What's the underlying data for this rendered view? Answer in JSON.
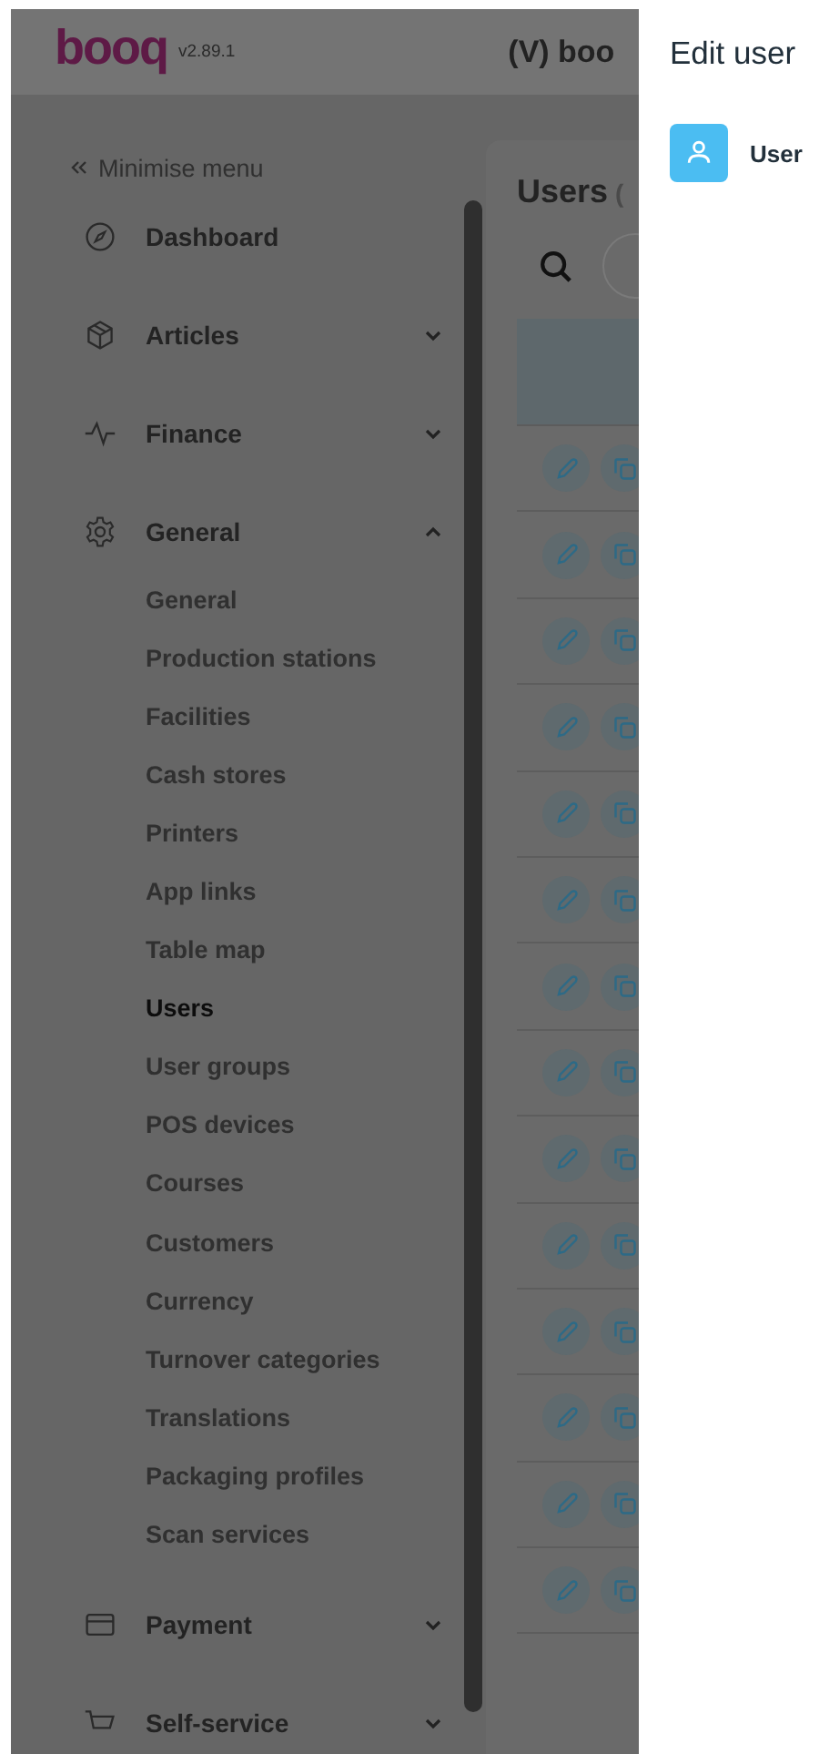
{
  "header": {
    "logo": "booq",
    "version": "v2.89.1",
    "title": "(V) boo"
  },
  "sidebar": {
    "minimise": "Minimise menu",
    "items": [
      {
        "label": "Dashboard",
        "kind": "link"
      },
      {
        "label": "Articles",
        "kind": "group",
        "expanded": false
      },
      {
        "label": "Finance",
        "kind": "group",
        "expanded": false
      },
      {
        "label": "General",
        "kind": "group",
        "expanded": true,
        "children": [
          {
            "label": "General",
            "selected": false
          },
          {
            "label": "Production stations",
            "selected": false
          },
          {
            "label": "Facilities",
            "selected": false
          },
          {
            "label": "Cash stores",
            "selected": false
          },
          {
            "label": "Printers",
            "selected": false
          },
          {
            "label": "App links",
            "selected": false
          },
          {
            "label": "Table map",
            "selected": false
          },
          {
            "label": "Users",
            "selected": true
          },
          {
            "label": "User groups",
            "selected": false
          },
          {
            "label": "POS devices",
            "selected": false
          },
          {
            "label": "Courses",
            "selected": false
          },
          {
            "label": "Customers",
            "selected": false
          },
          {
            "label": "Currency",
            "selected": false
          },
          {
            "label": "Turnover categories",
            "selected": false
          },
          {
            "label": "Translations",
            "selected": false
          },
          {
            "label": "Packaging profiles",
            "selected": false
          },
          {
            "label": "Scan services",
            "selected": false
          }
        ]
      },
      {
        "label": "Payment",
        "kind": "group",
        "expanded": false
      },
      {
        "label": "Self-service",
        "kind": "group",
        "expanded": false
      }
    ]
  },
  "content": {
    "title": "Users",
    "count": "("
  },
  "panel": {
    "title": "Edit user",
    "tabs": [
      {
        "label": "User",
        "selected": true
      }
    ]
  }
}
